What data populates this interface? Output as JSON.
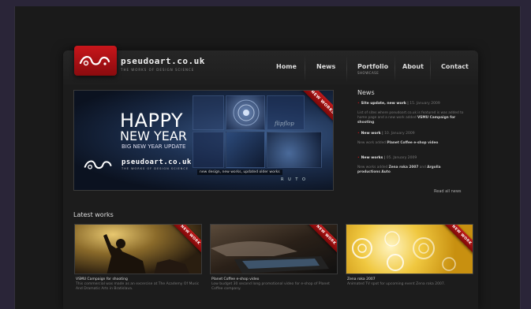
{
  "site": {
    "logo_text": "pseudoart.co.uk",
    "tagline": "THE WORKS OF DESIGN SCIENCE"
  },
  "nav": {
    "items": [
      {
        "label": "Home"
      },
      {
        "label": "News"
      },
      {
        "label": "Portfolio",
        "sub": "SHOWCASE"
      },
      {
        "label": "About"
      },
      {
        "label": "Contact"
      }
    ]
  },
  "hero": {
    "line1": "HAPPY",
    "line2": "NEW YEAR",
    "line3": "BIG NEW YEAR UPDATE",
    "url": "pseudoart.co.uk",
    "tagline": "THE WORKS OF DESIGN SCIENCE",
    "caption": "new design, new works, updated older works",
    "ribbon": "NEW WORKS",
    "rot_label": "R U T O",
    "script_label": "flipflop"
  },
  "news": {
    "title": "News",
    "items": [
      {
        "headline": "Site update, new work",
        "date": "15. January 2009",
        "body_pre": "List of sites where pseudoart.co.uk is featured is was added to home page and a new work added ",
        "body_bold": "VSMU Campaign for shooting",
        "body_post": "."
      },
      {
        "headline": "New work",
        "date": "10. January 2009",
        "body_pre": "New work added ",
        "body_bold": "Planet Coffee e-shop video",
        "body_post": "."
      },
      {
        "headline": "New works",
        "date": "05. January 2009",
        "body_pre": "New works added ",
        "body_bold": "Zena roka 2007",
        "body_mid": " and ",
        "body_bold2": "Argolla productions Auto",
        "body_post": "."
      }
    ],
    "read_all": "Read all news"
  },
  "latest": {
    "title": "Latest works",
    "works": [
      {
        "ribbon": "NEW WORK",
        "title": "VSMU Campaign for shooting",
        "desc": "This commercial was made as an excercise at The Academy Of Music And Dramatic Arts in Bratislava."
      },
      {
        "ribbon": "NEW WORK",
        "title": "Planet Coffee e-shop video",
        "desc": "Low budget 30 second long promotional video for e-shop of Planet Coffee company."
      },
      {
        "ribbon": "NEW WORK",
        "title": "Zena roka 2007",
        "desc": "Animated TV spot for upcoming event Zena roka 2007."
      }
    ]
  },
  "colors": {
    "accent": "#c8161b",
    "background": "#1a1a1a",
    "frame": "#2a2538"
  }
}
